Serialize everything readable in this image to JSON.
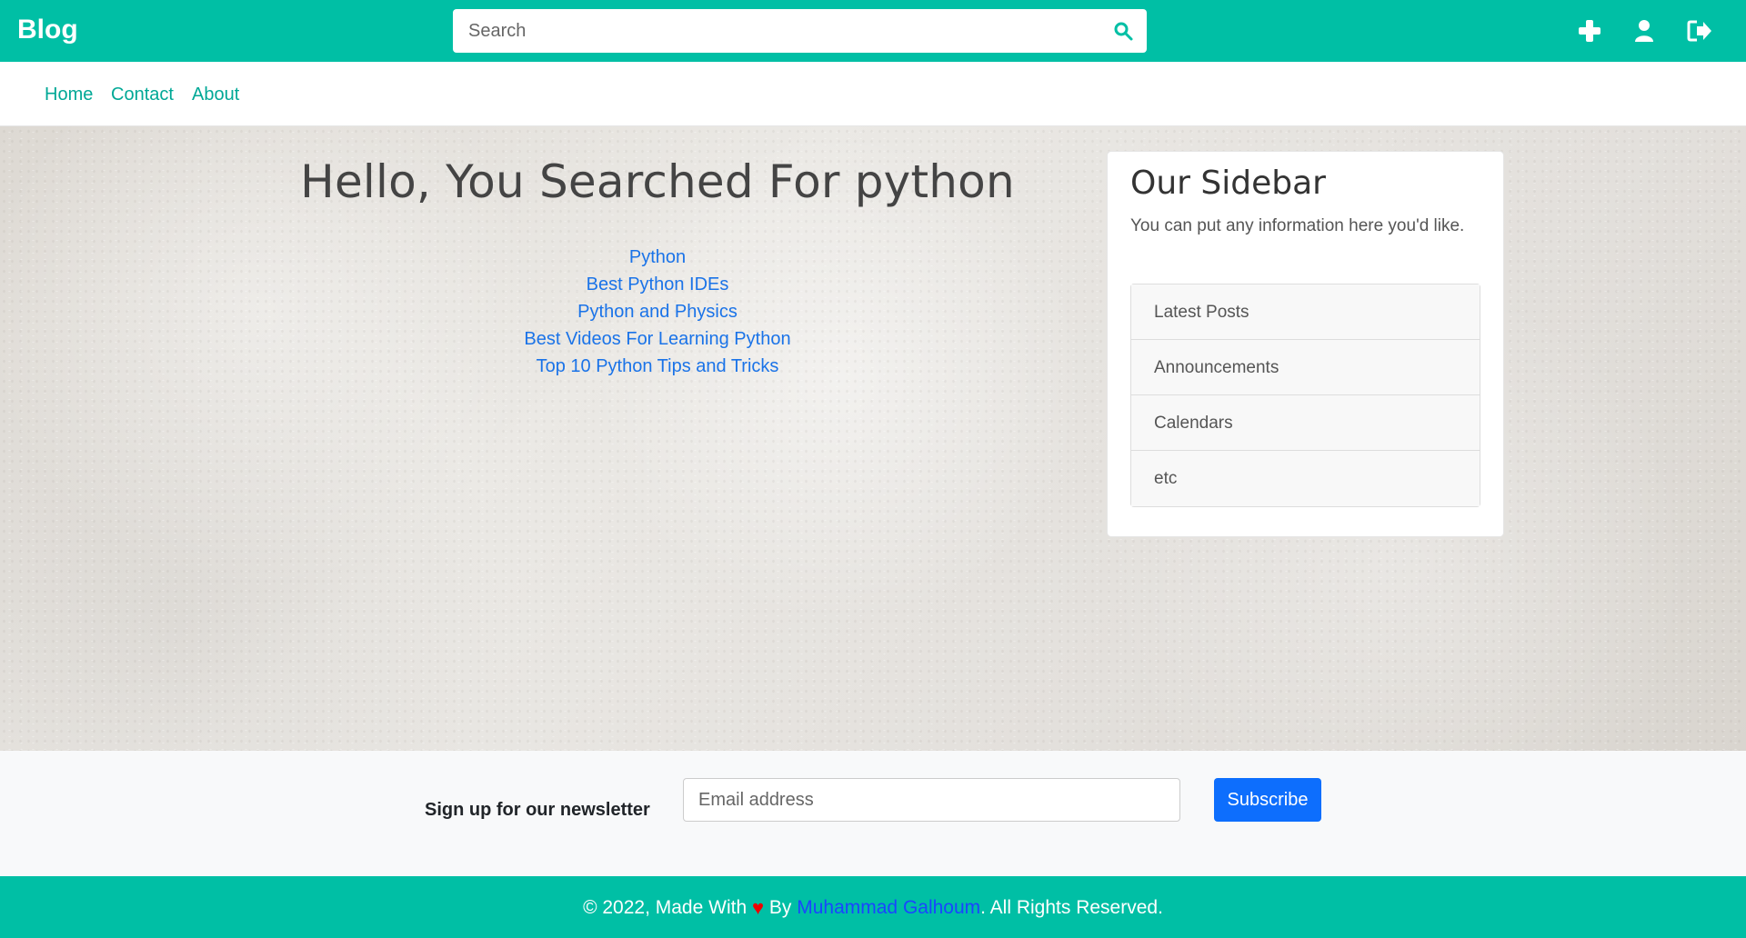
{
  "brand": "Blog",
  "search": {
    "placeholder": "Search",
    "icon": "search-icon"
  },
  "top_icons": [
    "plus-icon",
    "user-icon",
    "logout-icon"
  ],
  "nav": {
    "items": [
      {
        "label": "Home"
      },
      {
        "label": "Contact"
      },
      {
        "label": "About"
      }
    ]
  },
  "main": {
    "heading": "Hello, You Searched For python",
    "results": [
      {
        "label": "Python"
      },
      {
        "label": "Best Python IDEs"
      },
      {
        "label": "Python and Physics"
      },
      {
        "label": "Best Videos For Learning Python"
      },
      {
        "label": "Top 10 Python Tips and Tricks"
      }
    ]
  },
  "sidebar": {
    "title": "Our Sidebar",
    "text": "You can put any information here you'd like.",
    "items": [
      {
        "label": "Latest Posts"
      },
      {
        "label": "Announcements"
      },
      {
        "label": "Calendars"
      },
      {
        "label": "etc"
      }
    ]
  },
  "newsletter": {
    "label": "Sign up for our newsletter",
    "placeholder": "Email address",
    "button_label": "Subscribe"
  },
  "footer": {
    "prefix": "© 2022, Made With",
    "heart": "♥",
    "by": "By",
    "author": "Muhammad Galhoum",
    "suffix": ". All Rights Reserved."
  },
  "colors": {
    "accent": "#00bfa5",
    "link": "#1a73e8",
    "button": "#0d6efd"
  }
}
